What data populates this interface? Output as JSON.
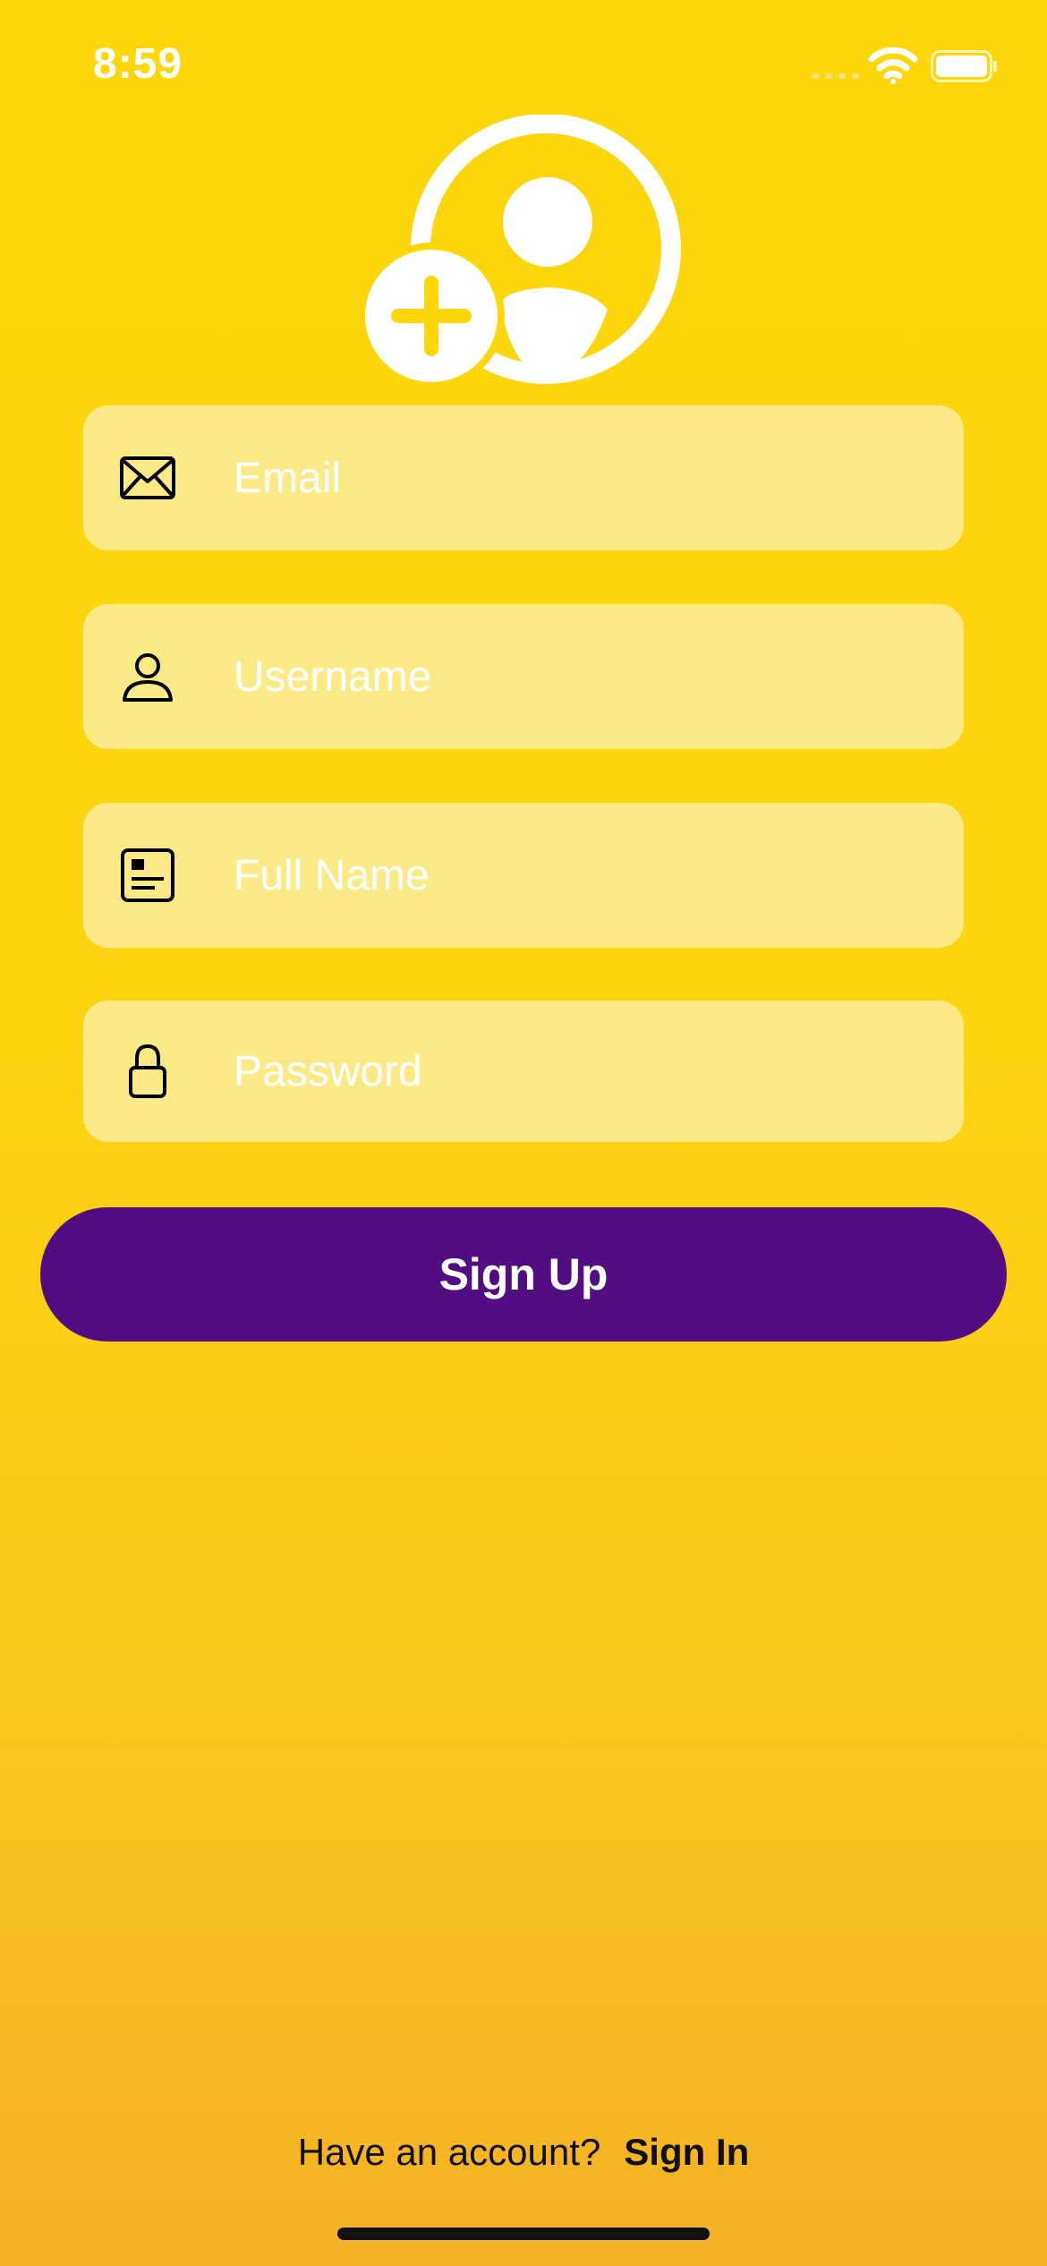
{
  "status_bar": {
    "time": "8:59",
    "icons": [
      "cellular-signal-icon",
      "wifi-icon",
      "battery-icon"
    ]
  },
  "header": {
    "icon": "person-add-icon"
  },
  "form": {
    "email": {
      "placeholder": "Email",
      "value": "",
      "icon": "envelope-icon"
    },
    "username": {
      "placeholder": "Username",
      "value": "",
      "icon": "person-icon"
    },
    "full_name": {
      "placeholder": "Full Name",
      "value": "",
      "icon": "id-card-icon"
    },
    "password": {
      "placeholder": "Password",
      "value": "",
      "icon": "lock-icon"
    }
  },
  "signup_label": "Sign Up",
  "footer": {
    "question": "Have an account?",
    "signin_label": "Sign In"
  },
  "colors": {
    "background_top": "#FFD60A",
    "background_bottom": "#F4B124",
    "field_fill": "#FDEA87",
    "button": "#520D82",
    "placeholder": "#FFFFFF"
  }
}
